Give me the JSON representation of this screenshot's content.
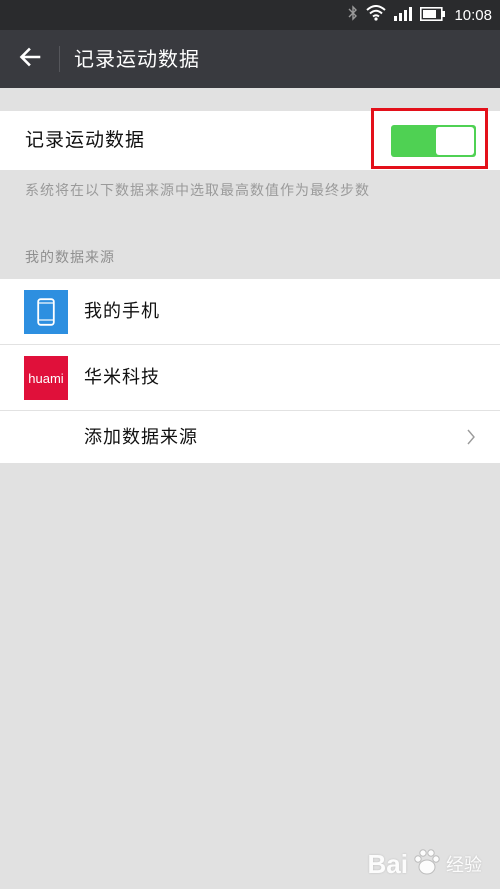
{
  "status_bar": {
    "time": "10:08"
  },
  "header": {
    "title": "记录运动数据"
  },
  "toggle": {
    "label": "记录运动数据",
    "state": "on",
    "color": "#4fd153"
  },
  "hint": "系统将在以下数据来源中选取最高数值作为最终步数",
  "sources": {
    "section_title": "我的数据来源",
    "items": [
      {
        "label": "我的手机",
        "icon": "phone-icon"
      },
      {
        "label": "华米科技",
        "icon": "huami-logo-icon",
        "logo_text": "huami"
      }
    ],
    "add_label": "添加数据来源"
  },
  "watermark": {
    "brand": "Bai",
    "brand_suffix": "经验"
  },
  "colors": {
    "status_bar": "#2a2b2d",
    "title_bar": "#393a3f",
    "background": "#e1e1e1",
    "highlight": "#e3101a",
    "phone_icon_bg": "#2d8fe0",
    "huami_bg": "#e0103a"
  }
}
